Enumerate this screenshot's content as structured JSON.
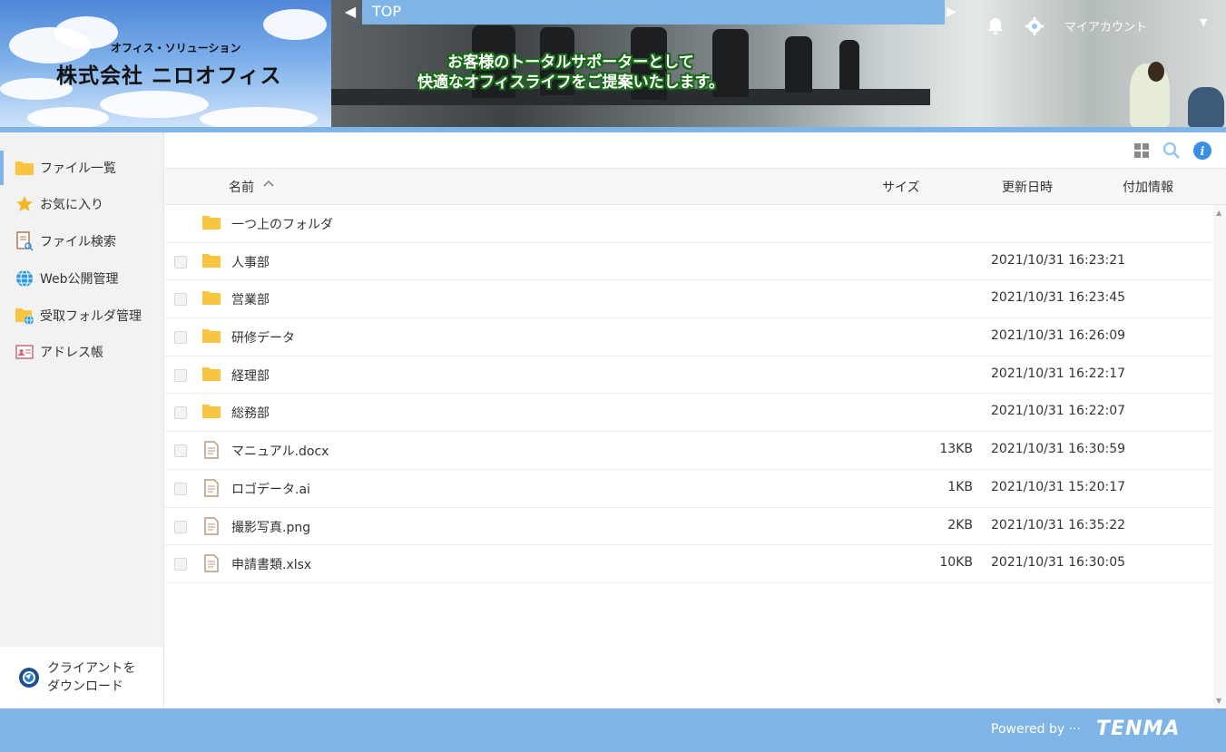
{
  "header": {
    "logo_sub": "オフィス・ソリューション",
    "logo_main": "株式会社 ニロオフィス",
    "tagline_line1": "お客様のトータルサポーターとして",
    "tagline_line2": "快適なオフィスライフをご提案いたします。",
    "breadcrumb": "TOP",
    "account_label": "マイアカウント",
    "icons": [
      "bell-icon",
      "gear-icon",
      "chevron-down-icon"
    ]
  },
  "sidebar": {
    "items": [
      {
        "label": "ファイル一覧",
        "icon": "folder-icon",
        "active": true
      },
      {
        "label": "お気に入り",
        "icon": "star-icon"
      },
      {
        "label": "ファイル検索",
        "icon": "file-search-icon"
      },
      {
        "label": "Web公開管理",
        "icon": "globe-icon"
      },
      {
        "label": "受取フォルダ管理",
        "icon": "receive-folder-icon"
      },
      {
        "label": "アドレス帳",
        "icon": "address-book-icon"
      }
    ],
    "download_line1": "クライアントを",
    "download_line2": "ダウンロード"
  },
  "table": {
    "headers": {
      "name": "名前",
      "size": "サイズ",
      "updated": "更新日時",
      "info": "付加情報"
    },
    "sort_indicator": "^",
    "parent_folder": "一つ上のフォルダ",
    "rows": [
      {
        "type": "folder",
        "name": "人事部",
        "size": "",
        "updated": "2021/10/31 16:23:21"
      },
      {
        "type": "folder",
        "name": "営業部",
        "size": "",
        "updated": "2021/10/31 16:23:45"
      },
      {
        "type": "folder",
        "name": "研修データ",
        "size": "",
        "updated": "2021/10/31 16:26:09"
      },
      {
        "type": "folder",
        "name": "経理部",
        "size": "",
        "updated": "2021/10/31 16:22:17"
      },
      {
        "type": "folder",
        "name": "総務部",
        "size": "",
        "updated": "2021/10/31 16:22:07"
      },
      {
        "type": "file",
        "name": "マニュアル.docx",
        "size": "13KB",
        "updated": "2021/10/31 16:30:59"
      },
      {
        "type": "file",
        "name": "ロゴデータ.ai",
        "size": "1KB",
        "updated": "2021/10/31 15:20:17"
      },
      {
        "type": "file",
        "name": "撮影写真.png",
        "size": "2KB",
        "updated": "2021/10/31 16:35:22"
      },
      {
        "type": "file",
        "name": "申請書類.xlsx",
        "size": "10KB",
        "updated": "2021/10/31 16:30:05"
      }
    ]
  },
  "footer": {
    "powered_by": "Powered by ···",
    "brand": "TENMA"
  },
  "colors": {
    "accent": "#7fb4e6",
    "folder": "#f9c440",
    "info": "#3a8ee6"
  }
}
